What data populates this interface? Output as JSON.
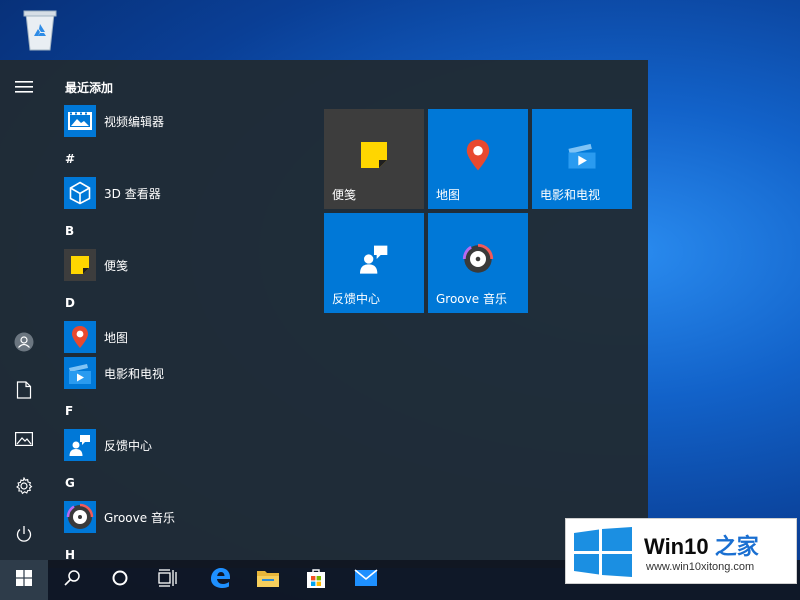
{
  "desktop": {
    "recycle_bin_icon": "recycle-bin-icon"
  },
  "start_menu": {
    "rail": {
      "items": [
        {
          "name": "hamburger-menu-icon"
        },
        {
          "name": "user-avatar-icon"
        },
        {
          "name": "documents-icon"
        },
        {
          "name": "pictures-icon"
        },
        {
          "name": "settings-icon"
        },
        {
          "name": "power-icon"
        }
      ]
    },
    "app_list": {
      "recently_added_header": "最近添加",
      "groups": {
        "hash": "#",
        "b": "B",
        "d": "D",
        "f": "F",
        "g": "G",
        "h": "H"
      },
      "apps": {
        "video_editor": "视频编辑器",
        "viewer_3d": "3D 查看器",
        "sticky_notes": "便笺",
        "maps": "地图",
        "movies_tv": "电影和电视",
        "feedback_hub": "反馈中心",
        "groove_music": "Groove 音乐"
      }
    },
    "tiles": {
      "sticky_notes": "便笺",
      "maps": "地图",
      "movies_tv": "电影和电视",
      "feedback_hub": "反馈中心",
      "groove_music": "Groove 音乐"
    }
  },
  "watermark": {
    "brand_prefix": "Win10",
    "brand_suffix": "之家",
    "url": "www.win10xitong.com"
  },
  "colors": {
    "tile_blue": "#0078d7",
    "sticky_tile": "#3d3d3d",
    "menu_bg": "#202b35",
    "taskbar_bg": "#10161f"
  }
}
